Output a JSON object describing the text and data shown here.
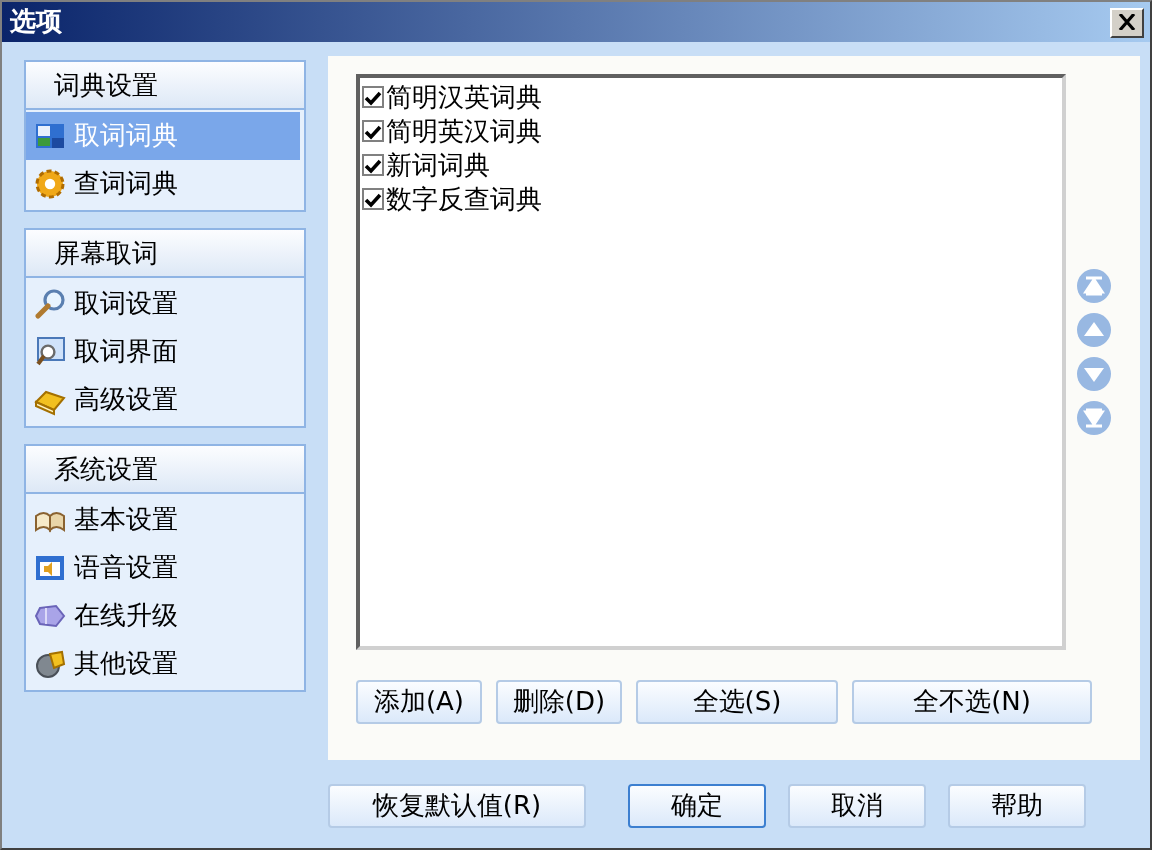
{
  "window": {
    "title": "选项"
  },
  "sidebar": {
    "groups": [
      {
        "header": "词典设置",
        "items": [
          {
            "label": "取词词典",
            "selected": true
          },
          {
            "label": "查词词典",
            "selected": false
          }
        ]
      },
      {
        "header": "屏幕取词",
        "items": [
          {
            "label": "取词设置",
            "selected": false
          },
          {
            "label": "取词界面",
            "selected": false
          },
          {
            "label": "高级设置",
            "selected": false
          }
        ]
      },
      {
        "header": "系统设置",
        "items": [
          {
            "label": "基本设置",
            "selected": false
          },
          {
            "label": "语音设置",
            "selected": false
          },
          {
            "label": "在线升级",
            "selected": false
          },
          {
            "label": "其他设置",
            "selected": false
          }
        ]
      }
    ]
  },
  "dictionaries": [
    {
      "label": "简明汉英词典",
      "checked": true
    },
    {
      "label": "简明英汉词典",
      "checked": true
    },
    {
      "label": "新词词典",
      "checked": true
    },
    {
      "label": "数字反查词典",
      "checked": true
    }
  ],
  "list_buttons": [
    "添加(A)",
    "删除(D)",
    "全选(S)",
    "全不选(N)"
  ],
  "dialog_buttons": [
    {
      "label": "恢复默认值(R)",
      "default": false
    },
    {
      "label": "确定",
      "default": true
    },
    {
      "label": "取消",
      "default": false
    },
    {
      "label": "帮助",
      "default": false
    }
  ]
}
